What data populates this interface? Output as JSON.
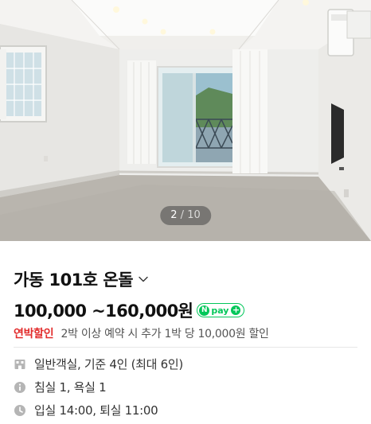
{
  "gallery": {
    "current": "2",
    "separator": "/",
    "total": "10"
  },
  "room": {
    "title": "가동 101호 온돌",
    "price": "100,000 ~160,000원",
    "npay_label": "pay",
    "discount_label": "연박할인",
    "discount_text": "2박 이상 예약 시 추가 1박 당 10,000원 할인"
  },
  "specs": {
    "room_type": "일반객실, 기준 4인 (최대 6인)",
    "rooms": "침실 1, 욕실 1",
    "check_times": "입실 14:00, 퇴실 11:00"
  },
  "colors": {
    "discount": "#e22b2b",
    "npay_green": "#03c75a",
    "icon_gray": "#b5b5b5"
  },
  "icons": [
    "chevron-down-icon",
    "npay-logo",
    "building-icon",
    "info-icon",
    "clock-icon"
  ]
}
